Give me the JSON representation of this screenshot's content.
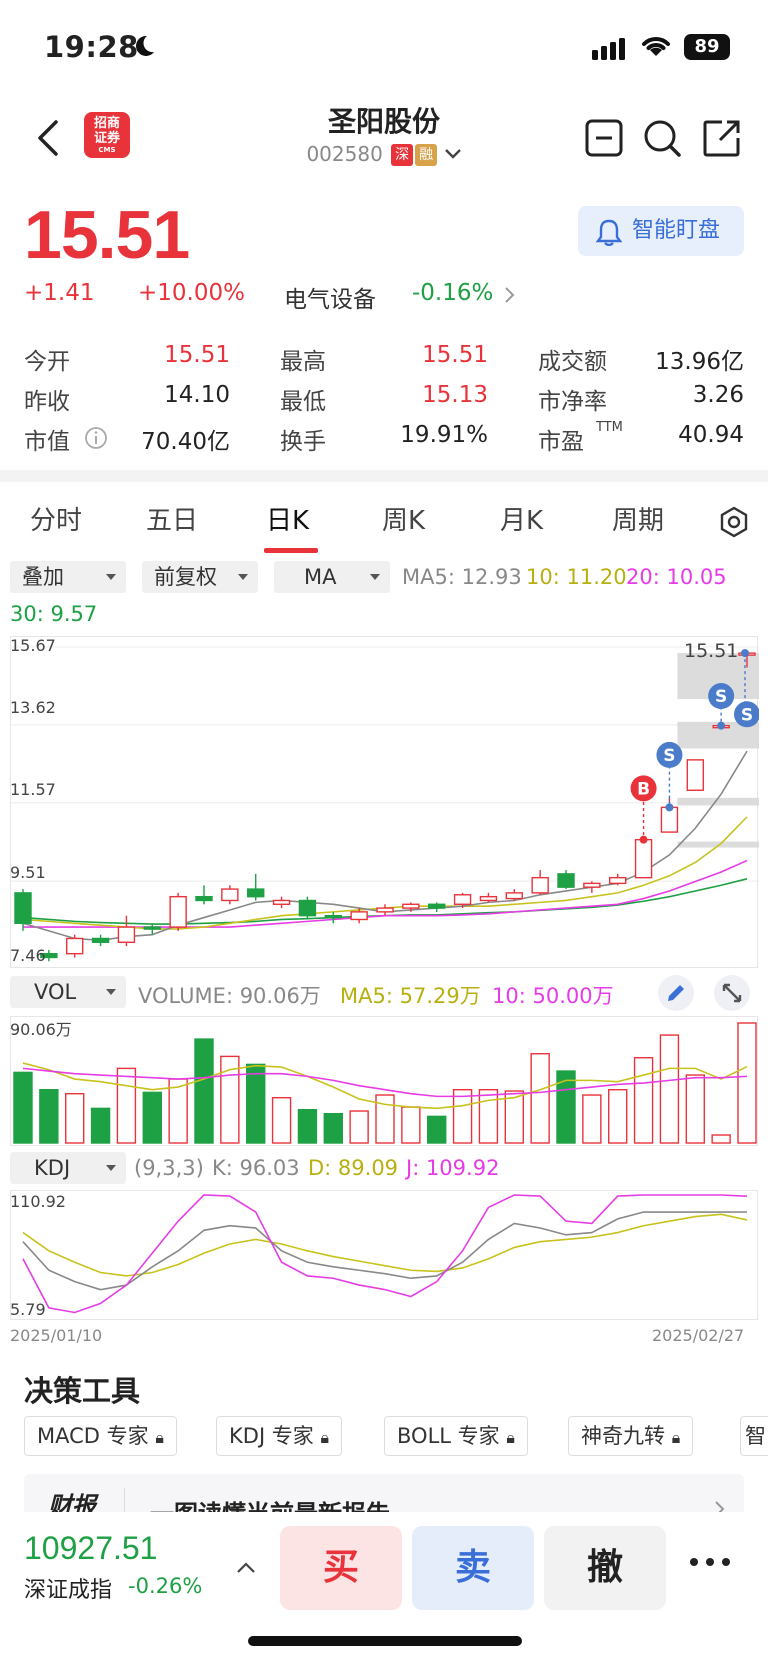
{
  "status": {
    "time": "19:28",
    "battery": "89"
  },
  "header": {
    "logo_line1": "招商",
    "logo_line2": "证券",
    "logo_sub": "CMS",
    "title": "圣阳股份",
    "code": "002580",
    "tag_shen": "深",
    "tag_rong": "融"
  },
  "quote": {
    "price": "15.51",
    "change": "+1.41",
    "change_pct": "+10.00%",
    "sector": "电气设备",
    "sector_pct": "-0.16%",
    "watch_label": "智能盯盘",
    "rows": [
      [
        {
          "label": "今开",
          "value": "15.51"
        },
        {
          "label": "最高",
          "value": "15.51"
        },
        {
          "label": "成交额",
          "value": "13.96亿"
        }
      ],
      [
        {
          "label": "昨收",
          "value": "14.10"
        },
        {
          "label": "最低",
          "value": "15.13"
        },
        {
          "label": "市净率",
          "value": "3.26"
        }
      ],
      [
        {
          "label": "市值",
          "value": "70.40亿"
        },
        {
          "label": "换手",
          "value": "19.91%"
        },
        {
          "label": "市盈",
          "value": "40.94"
        }
      ]
    ],
    "ttm": "TTM"
  },
  "tabs": [
    "分时",
    "五日",
    "日K",
    "周K",
    "月K",
    "周期"
  ],
  "kline_controls": {
    "overlay": "叠加",
    "adjust": "前复权",
    "ma": "MA",
    "ma5": "MA5: 12.93",
    "ma10": "10: 11.20",
    "ma20": "20: 10.05",
    "ma30": "30: 9.57"
  },
  "kline_axis": {
    "y1": "15.67",
    "y2": "13.62",
    "y3": "11.57",
    "y4": "9.51",
    "y5": "7.46",
    "last_label": "15.51"
  },
  "vol_controls": {
    "label": "VOL",
    "volume": "VOLUME: 90.06万",
    "ma5": "MA5: 57.29万",
    "ma10": "10: 50.00万",
    "max": "90.06万"
  },
  "kdj_controls": {
    "label": "KDJ",
    "params": "(9,3,3)",
    "k": "K: 96.03",
    "d": "D: 89.09",
    "j": "J: 109.92",
    "max": "110.92",
    "min": "5.79"
  },
  "dates": {
    "start": "2025/01/10",
    "end": "2025/02/27"
  },
  "tools": {
    "title": "决策工具",
    "items": [
      "MACD 专家",
      "KDJ 专家",
      "BOLL 专家",
      "神奇九转",
      "智"
    ]
  },
  "report": {
    "tag": "财报",
    "text": "一图读懂当前最新报告"
  },
  "index": {
    "value": "10927.51",
    "name": "深证成指",
    "pct": "-0.26%"
  },
  "actions": {
    "buy": "买",
    "sell": "卖",
    "cancel": "撤"
  },
  "markers": {
    "buy": "B",
    "sell": "S"
  },
  "colors": {
    "up": "#e8333a",
    "down": "#1ea044",
    "ma5": "#888888",
    "ma10": "#c8c21c",
    "ma20": "#e63ce6",
    "ma30": "#1ea044"
  },
  "chart_data": {
    "type": "candlestick",
    "x_start": "2025/01/10",
    "x_end": "2025/02/27",
    "ylim": [
      7.46,
      15.67
    ],
    "candles": [
      {
        "o": 9.2,
        "c": 8.4,
        "h": 9.3,
        "l": 8.2,
        "up": false
      },
      {
        "o": 7.6,
        "c": 7.5,
        "h": 7.7,
        "l": 7.4,
        "up": false
      },
      {
        "o": 7.6,
        "c": 8.0,
        "h": 8.1,
        "l": 7.5,
        "up": true
      },
      {
        "o": 8.0,
        "c": 7.9,
        "h": 8.1,
        "l": 7.8,
        "up": false
      },
      {
        "o": 7.9,
        "c": 8.3,
        "h": 8.6,
        "l": 7.8,
        "up": true
      },
      {
        "o": 8.3,
        "c": 8.25,
        "h": 8.4,
        "l": 8.1,
        "up": false
      },
      {
        "o": 8.3,
        "c": 9.1,
        "h": 9.2,
        "l": 8.2,
        "up": true
      },
      {
        "o": 9.1,
        "c": 9.0,
        "h": 9.4,
        "l": 8.9,
        "up": false
      },
      {
        "o": 9.0,
        "c": 9.3,
        "h": 9.4,
        "l": 8.9,
        "up": true
      },
      {
        "o": 9.3,
        "c": 9.1,
        "h": 9.7,
        "l": 9.0,
        "up": false
      },
      {
        "o": 8.9,
        "c": 9.0,
        "h": 9.1,
        "l": 8.8,
        "up": true
      },
      {
        "o": 9.0,
        "c": 8.6,
        "h": 9.1,
        "l": 8.5,
        "up": false
      },
      {
        "o": 8.6,
        "c": 8.55,
        "h": 8.7,
        "l": 8.4,
        "up": false
      },
      {
        "o": 8.5,
        "c": 8.7,
        "h": 8.8,
        "l": 8.4,
        "up": true
      },
      {
        "o": 8.7,
        "c": 8.8,
        "h": 8.9,
        "l": 8.6,
        "up": true
      },
      {
        "o": 8.8,
        "c": 8.9,
        "h": 8.95,
        "l": 8.7,
        "up": true
      },
      {
        "o": 8.9,
        "c": 8.8,
        "h": 8.95,
        "l": 8.7,
        "up": false
      },
      {
        "o": 8.9,
        "c": 9.15,
        "h": 9.2,
        "l": 8.8,
        "up": true
      },
      {
        "o": 9.0,
        "c": 9.1,
        "h": 9.2,
        "l": 8.95,
        "up": true
      },
      {
        "o": 9.05,
        "c": 9.2,
        "h": 9.3,
        "l": 9.0,
        "up": true
      },
      {
        "o": 9.2,
        "c": 9.6,
        "h": 9.8,
        "l": 9.15,
        "up": true
      },
      {
        "o": 9.7,
        "c": 9.35,
        "h": 9.8,
        "l": 9.3,
        "up": false
      },
      {
        "o": 9.35,
        "c": 9.45,
        "h": 9.5,
        "l": 9.2,
        "up": true
      },
      {
        "o": 9.45,
        "c": 9.6,
        "h": 9.7,
        "l": 9.4,
        "up": true
      },
      {
        "o": 9.6,
        "c": 10.6,
        "h": 10.6,
        "l": 9.6,
        "up": true
      },
      {
        "o": 10.8,
        "c": 11.45,
        "h": 11.7,
        "l": 10.8,
        "up": true
      },
      {
        "o": 11.9,
        "c": 12.7,
        "h": 12.7,
        "l": 11.9,
        "up": true
      },
      {
        "o": 13.6,
        "c": 13.6,
        "h": 13.7,
        "l": 13.5,
        "up": true
      },
      {
        "o": 15.51,
        "c": 15.51,
        "h": 15.51,
        "l": 15.13,
        "up": true
      }
    ],
    "ma5": [
      8.4,
      8.2,
      8.0,
      7.95,
      8.05,
      8.1,
      8.35,
      8.55,
      8.75,
      8.95,
      9.0,
      8.95,
      8.9,
      8.8,
      8.7,
      8.75,
      8.8,
      8.85,
      8.95,
      9.0,
      9.15,
      9.25,
      9.35,
      9.45,
      9.75,
      10.2,
      10.9,
      11.8,
      12.93
    ],
    "ma10": [
      8.5,
      8.45,
      8.4,
      8.35,
      8.3,
      8.25,
      8.25,
      8.3,
      8.4,
      8.5,
      8.6,
      8.65,
      8.7,
      8.75,
      8.8,
      8.85,
      8.85,
      8.85,
      8.85,
      8.9,
      8.95,
      9.0,
      9.1,
      9.2,
      9.4,
      9.65,
      10.0,
      10.5,
      11.2
    ],
    "ma20": [
      8.3,
      8.3,
      8.3,
      8.3,
      8.3,
      8.3,
      8.3,
      8.3,
      8.3,
      8.35,
      8.4,
      8.45,
      8.5,
      8.55,
      8.6,
      8.6,
      8.6,
      8.62,
      8.65,
      8.7,
      8.75,
      8.8,
      8.85,
      8.9,
      9.05,
      9.25,
      9.5,
      9.75,
      10.05
    ],
    "ma30": [
      8.55,
      8.5,
      8.45,
      8.42,
      8.4,
      8.38,
      8.38,
      8.4,
      8.42,
      8.45,
      8.5,
      8.52,
      8.55,
      8.58,
      8.6,
      8.62,
      8.62,
      8.65,
      8.68,
      8.7,
      8.74,
      8.78,
      8.82,
      8.88,
      8.98,
      9.1,
      9.25,
      9.4,
      9.57
    ],
    "volume": {
      "max": 90.06,
      "values": [
        53,
        40,
        37,
        26,
        56,
        38,
        48,
        78,
        65,
        59,
        34,
        25,
        22,
        24,
        36,
        27,
        20,
        40,
        40,
        39,
        67,
        54,
        36,
        40,
        64,
        81,
        51,
        6,
        90.06
      ],
      "ma5": [
        60,
        55,
        48,
        46,
        43,
        40,
        42,
        48,
        55,
        58,
        57,
        50,
        42,
        33,
        29,
        27,
        26,
        28,
        32,
        34,
        40,
        47,
        47,
        46,
        51,
        56,
        56,
        48,
        57.29
      ],
      "ma10": [
        56,
        54,
        52,
        51,
        50,
        49,
        48,
        49,
        51,
        52,
        52,
        50,
        47,
        43,
        40,
        37,
        35,
        35,
        36,
        37,
        38,
        40,
        42,
        44,
        45,
        47,
        49,
        49,
        50.0
      ]
    },
    "kdj": {
      "ylim": [
        5.79,
        110.92
      ],
      "k": [
        70,
        45,
        35,
        28,
        32,
        48,
        62,
        80,
        84,
        82,
        62,
        52,
        48,
        45,
        42,
        38,
        40,
        52,
        72,
        86,
        82,
        76,
        78,
        90,
        96,
        96,
        96,
        96,
        96.03
      ],
      "d": [
        78,
        62,
        52,
        43,
        40,
        43,
        50,
        60,
        68,
        72,
        68,
        62,
        57,
        53,
        49,
        45,
        44,
        47,
        55,
        65,
        70,
        72,
        74,
        78,
        84,
        88,
        92,
        94,
        89.09
      ],
      "j": [
        55,
        12,
        8,
        16,
        32,
        60,
        88,
        112,
        110,
        96,
        52,
        40,
        38,
        32,
        28,
        22,
        35,
        62,
        100,
        120,
        110,
        88,
        86,
        110,
        118,
        118,
        118,
        118,
        109.92
      ]
    }
  }
}
